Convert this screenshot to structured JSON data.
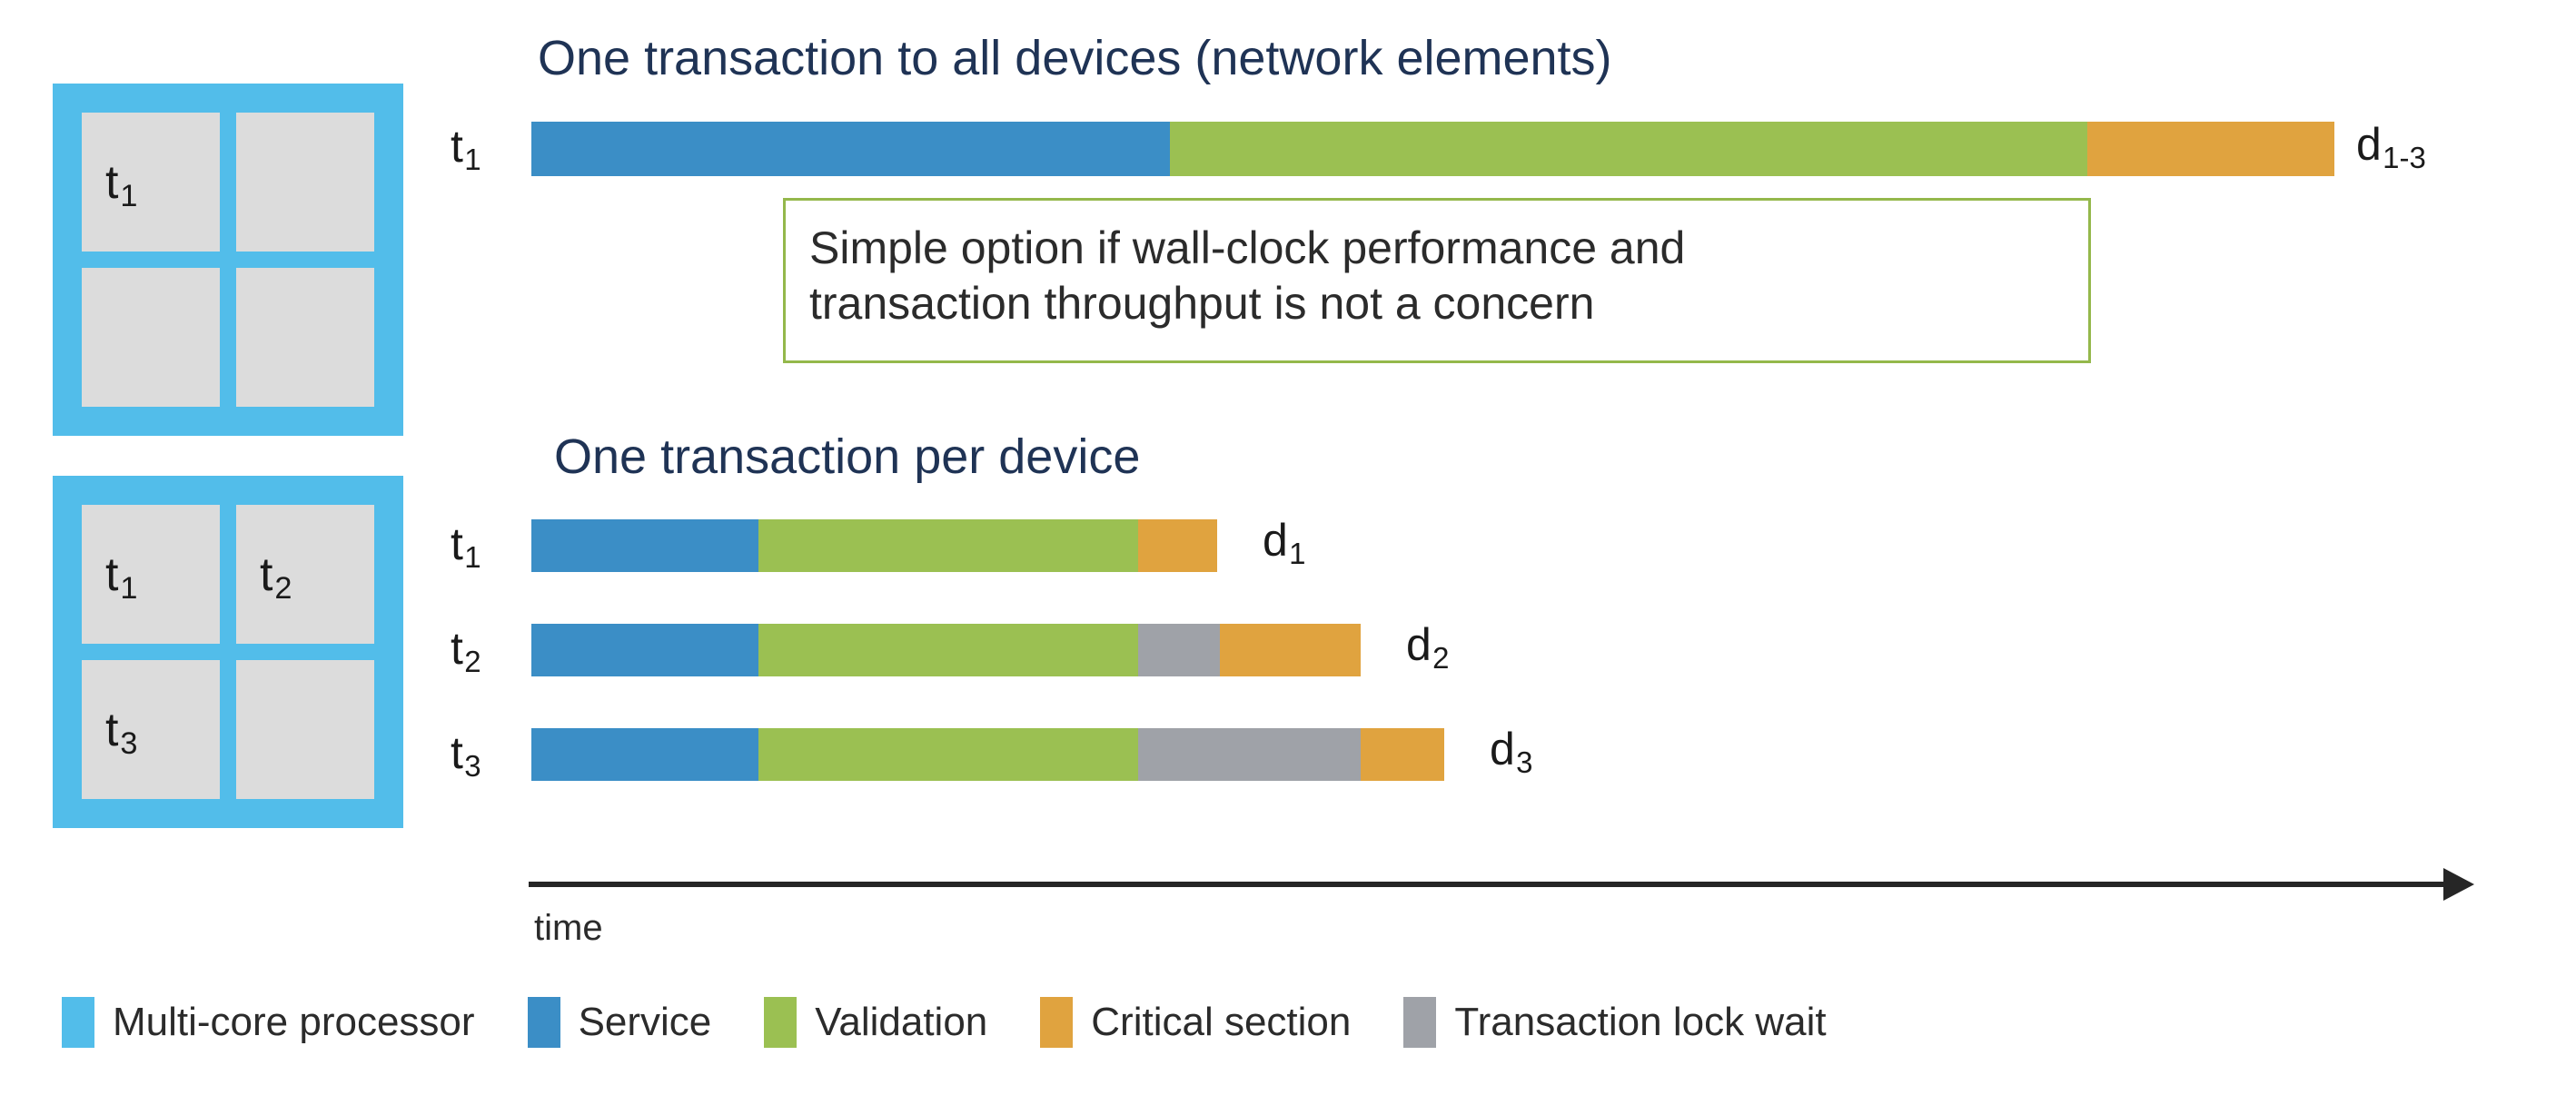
{
  "palette": {
    "multicore_processor": "#52bdea",
    "core_fill": "#dcdcdc",
    "service": "#3b8ec6",
    "validation": "#9bc052",
    "critical_section": "#e0a33f",
    "transaction_lock_wait": "#9fa2a8",
    "heading_navy": "#1f3355",
    "callout_border": "#94b84b",
    "axis": "#262626"
  },
  "processors": [
    {
      "name": "single-transaction-processor",
      "cores": [
        {
          "label": "t",
          "sub": "1"
        },
        {
          "label": "",
          "sub": ""
        },
        {
          "label": "",
          "sub": ""
        },
        {
          "label": "",
          "sub": ""
        }
      ]
    },
    {
      "name": "multi-transaction-processor",
      "cores": [
        {
          "label": "t",
          "sub": "1"
        },
        {
          "label": "t",
          "sub": "2"
        },
        {
          "label": "t",
          "sub": "3"
        },
        {
          "label": "",
          "sub": ""
        }
      ]
    }
  ],
  "sections": [
    {
      "title": "One transaction to all devices (network elements)"
    },
    {
      "title": "One transaction per device"
    }
  ],
  "callout": {
    "line1": "Simple option if wall-clock performance and",
    "line2": "transaction throughput is not a concern"
  },
  "axis": {
    "caption": "time"
  },
  "legend": [
    {
      "label": "Multi-core processor",
      "color": "#52bdea"
    },
    {
      "label": "Service",
      "color": "#3b8ec6"
    },
    {
      "label": "Validation",
      "color": "#9bc052"
    },
    {
      "label": "Critical section",
      "color": "#e0a33f"
    },
    {
      "label": "Transaction lock wait",
      "color": "#9fa2a8"
    }
  ],
  "chart_data": {
    "type": "bar",
    "title": "Transaction scheduling on a multi-core processor",
    "xlabel": "time",
    "ylabel": "",
    "orientation": "horizontal-stacked",
    "units": "relative time (pixels on the time axis)",
    "stage_colors": {
      "Service": "#3b8ec6",
      "Validation": "#9bc052",
      "Transaction lock wait": "#9fa2a8",
      "Critical section": "#e0a33f"
    },
    "groups": [
      {
        "name": "One transaction to all devices (network elements)",
        "rows": [
          {
            "row_label": "t",
            "row_sub": "1",
            "end_label": "d",
            "end_sub": "1-3",
            "start": 0,
            "total": 1985,
            "segments": [
              {
                "stage": "Service",
                "value": 703
              },
              {
                "stage": "Validation",
                "value": 1010
              },
              {
                "stage": "Critical section",
                "value": 272
              }
            ]
          }
        ]
      },
      {
        "name": "One transaction per device",
        "rows": [
          {
            "row_label": "t",
            "row_sub": "1",
            "end_label": "d",
            "end_sub": "1",
            "start": 0,
            "total": 755,
            "segments": [
              {
                "stage": "Service",
                "value": 250
              },
              {
                "stage": "Validation",
                "value": 418
              },
              {
                "stage": "Transaction lock wait",
                "value": 0
              },
              {
                "stage": "Critical section",
                "value": 87
              }
            ]
          },
          {
            "row_label": "t",
            "row_sub": "2",
            "end_label": "d",
            "end_sub": "2",
            "start": 0,
            "total": 913,
            "segments": [
              {
                "stage": "Service",
                "value": 250
              },
              {
                "stage": "Validation",
                "value": 418
              },
              {
                "stage": "Transaction lock wait",
                "value": 90
              },
              {
                "stage": "Critical section",
                "value": 155
              }
            ]
          },
          {
            "row_label": "t",
            "row_sub": "3",
            "end_label": "d",
            "end_sub": "3",
            "start": 0,
            "total": 1005,
            "segments": [
              {
                "stage": "Service",
                "value": 250
              },
              {
                "stage": "Validation",
                "value": 418
              },
              {
                "stage": "Transaction lock wait",
                "value": 245
              },
              {
                "stage": "Critical section",
                "value": 92
              }
            ]
          }
        ]
      }
    ]
  }
}
